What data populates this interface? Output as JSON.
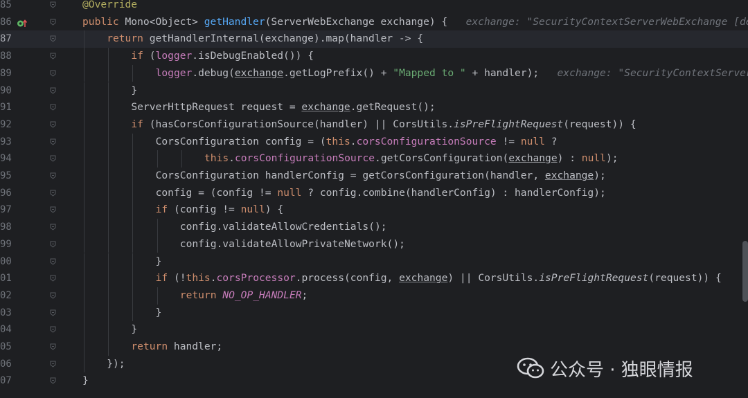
{
  "lines": [
    {
      "num": "85",
      "current": false,
      "indent": 0,
      "tokens": [
        [
          "ann",
          "@Override"
        ]
      ]
    },
    {
      "num": "86",
      "current": false,
      "indent": 0,
      "tokens": [
        [
          "kw",
          "public "
        ],
        [
          "",
          "Mono<Object> "
        ],
        [
          "fn",
          "getHandler"
        ],
        [
          "",
          "(ServerWebExchange exchange) {   "
        ],
        [
          "hint",
          "exchange: \"SecurityContextServerWebExchange [de"
        ]
      ]
    },
    {
      "num": "87",
      "current": true,
      "indent": 1,
      "tokens": [
        [
          "kw",
          "return "
        ],
        [
          "",
          "getHandlerInternal(exchange).map(handler -> {"
        ]
      ]
    },
    {
      "num": "88",
      "current": false,
      "indent": 2,
      "tokens": [
        [
          "kw",
          "if "
        ],
        [
          "",
          "("
        ],
        [
          "fld",
          "logger"
        ],
        [
          "",
          ".isDebugEnabled()) {"
        ]
      ]
    },
    {
      "num": "89",
      "current": false,
      "indent": 3,
      "tokens": [
        [
          "fld",
          "logger"
        ],
        [
          "",
          ".debug("
        ],
        [
          "u",
          "exchange"
        ],
        [
          "",
          ".getLogPrefix() + "
        ],
        [
          "str",
          "\"Mapped to \""
        ],
        [
          "",
          " + handler);   "
        ],
        [
          "hint",
          "exchange: \"SecurityContextServer"
        ]
      ]
    },
    {
      "num": "90",
      "current": false,
      "indent": 2,
      "tokens": [
        [
          "",
          "}"
        ]
      ]
    },
    {
      "num": "91",
      "current": false,
      "indent": 2,
      "tokens": [
        [
          "",
          "ServerHttpRequest request = "
        ],
        [
          "u",
          "exchange"
        ],
        [
          "",
          ".getRequest();"
        ]
      ]
    },
    {
      "num": "92",
      "current": false,
      "indent": 2,
      "tokens": [
        [
          "kw",
          "if "
        ],
        [
          "",
          "(hasCorsConfigurationSource(handler) || CorsUtils."
        ],
        [
          "it",
          "isPreFlightRequest"
        ],
        [
          "",
          "(request)) {"
        ]
      ]
    },
    {
      "num": "93",
      "current": false,
      "indent": 3,
      "tokens": [
        [
          "",
          "CorsConfiguration config = ("
        ],
        [
          "kw",
          "this"
        ],
        [
          "",
          "."
        ],
        [
          "fld",
          "corsConfigurationSource"
        ],
        [
          "",
          " != "
        ],
        [
          "kw",
          "null"
        ],
        [
          "",
          " ?"
        ]
      ]
    },
    {
      "num": "94",
      "current": false,
      "indent": 5,
      "tokens": [
        [
          "kw",
          "this"
        ],
        [
          "",
          "."
        ],
        [
          "fld",
          "corsConfigurationSource"
        ],
        [
          "",
          ".getCorsConfiguration("
        ],
        [
          "u",
          "exchange"
        ],
        [
          "",
          ") : "
        ],
        [
          "kw",
          "null"
        ],
        [
          "",
          ");"
        ]
      ]
    },
    {
      "num": "95",
      "current": false,
      "indent": 3,
      "tokens": [
        [
          "",
          "CorsConfiguration handlerConfig = getCorsConfiguration(handler, "
        ],
        [
          "u",
          "exchange"
        ],
        [
          "",
          ");"
        ]
      ]
    },
    {
      "num": "96",
      "current": false,
      "indent": 3,
      "tokens": [
        [
          "",
          "config = (config != "
        ],
        [
          "kw",
          "null"
        ],
        [
          "",
          " ? config.combine(handlerConfig) : handlerConfig);"
        ]
      ]
    },
    {
      "num": "97",
      "current": false,
      "indent": 3,
      "tokens": [
        [
          "kw",
          "if "
        ],
        [
          "",
          "(config != "
        ],
        [
          "kw",
          "null"
        ],
        [
          "",
          ") {"
        ]
      ]
    },
    {
      "num": "98",
      "current": false,
      "indent": 4,
      "tokens": [
        [
          "",
          "config.validateAllowCredentials();"
        ]
      ]
    },
    {
      "num": "99",
      "current": false,
      "indent": 4,
      "tokens": [
        [
          "",
          "config.validateAllowPrivateNetwork();"
        ]
      ]
    },
    {
      "num": "00",
      "current": false,
      "indent": 3,
      "tokens": [
        [
          "",
          "}"
        ]
      ]
    },
    {
      "num": "01",
      "current": false,
      "indent": 3,
      "tokens": [
        [
          "kw",
          "if "
        ],
        [
          "",
          "(!"
        ],
        [
          "kw",
          "this"
        ],
        [
          "",
          "."
        ],
        [
          "fld",
          "corsProcessor"
        ],
        [
          "",
          ".process(config, "
        ],
        [
          "u",
          "exchange"
        ],
        [
          "",
          ") || CorsUtils."
        ],
        [
          "it",
          "isPreFlightRequest"
        ],
        [
          "",
          "(request)) {"
        ]
      ]
    },
    {
      "num": "02",
      "current": false,
      "indent": 4,
      "tokens": [
        [
          "kw",
          "return "
        ],
        [
          "const",
          "NO_OP_HANDLER"
        ],
        [
          "",
          ";"
        ]
      ]
    },
    {
      "num": "03",
      "current": false,
      "indent": 3,
      "tokens": [
        [
          "",
          "}"
        ]
      ]
    },
    {
      "num": "04",
      "current": false,
      "indent": 2,
      "tokens": [
        [
          "",
          "}"
        ]
      ]
    },
    {
      "num": "05",
      "current": false,
      "indent": 2,
      "tokens": [
        [
          "kw",
          "return "
        ],
        [
          "",
          "handler;"
        ]
      ]
    },
    {
      "num": "06",
      "current": false,
      "indent": 1,
      "tokens": [
        [
          "",
          "});"
        ]
      ]
    },
    {
      "num": "07",
      "current": false,
      "indent": 0,
      "tokens": [
        [
          "",
          "}"
        ]
      ]
    }
  ],
  "watermark": {
    "text": "公众号 · 独眼情报",
    "logo_icon": "wechat-logo-icon"
  }
}
